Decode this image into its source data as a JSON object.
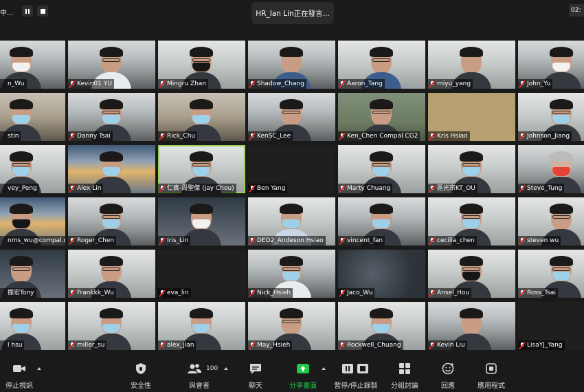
{
  "topbar": {
    "recording_text": "中...",
    "active_speaker": "HR_Ian Lin正在發言...",
    "timer": "02:"
  },
  "participants": [
    {
      "name": "n_Wu"
    },
    {
      "name": "Kevin01 YU"
    },
    {
      "name": "Mingru Zhan"
    },
    {
      "name": "Shadow_Chang"
    },
    {
      "name": "Aaron_Tang"
    },
    {
      "name": "miyu_yang"
    },
    {
      "name": "John_Yu"
    },
    {
      "name": "stin"
    },
    {
      "name": "Danny Tsai"
    },
    {
      "name": "Rick_Chu"
    },
    {
      "name": "KenSC_Lee"
    },
    {
      "name": "Ken_Chen Compal CG2"
    },
    {
      "name": "Kris Hsiao"
    },
    {
      "name": "Johnson_Jiang"
    },
    {
      "name": "vey_Peng"
    },
    {
      "name": "Alex Lin"
    },
    {
      "name": "仁賓-周聖傑 (Jay Chou)"
    },
    {
      "name": "Ben Yang"
    },
    {
      "name": "Marty Chuang"
    },
    {
      "name": "區光宗KT_OU"
    },
    {
      "name": "Steve_Tung"
    },
    {
      "name": "nms_wu@compal.c..."
    },
    {
      "name": "Roger_Chen"
    },
    {
      "name": "Iris_Lin"
    },
    {
      "name": "DED2_Andeson Hsiao"
    },
    {
      "name": "vincent_fan"
    },
    {
      "name": "cecilia_chen"
    },
    {
      "name": "steven wu"
    },
    {
      "name": "振宏Tony"
    },
    {
      "name": "Frankkk_Wu"
    },
    {
      "name": "eva_lin"
    },
    {
      "name": "Nick_Hsieh"
    },
    {
      "name": "Jaco_Wu"
    },
    {
      "name": "Ansel_Hou"
    },
    {
      "name": "Ross_Tsai"
    },
    {
      "name": "l hsu"
    },
    {
      "name": "miller_su"
    },
    {
      "name": "alex_jian"
    },
    {
      "name": "May_Hsieh"
    },
    {
      "name": "Rockwell_Chuang"
    },
    {
      "name": "Kevin Liu"
    },
    {
      "name": "LisaYJ_Yang"
    }
  ],
  "toolbar": {
    "stop_video": "停止視訊",
    "security": "安全性",
    "participants": "與會者",
    "participant_count": "100",
    "chat": "聊天",
    "share_screen": "分享畫面",
    "pause_recording": "暫停/停止錄製",
    "breakout": "分組討論",
    "reactions": "回應",
    "apps": "應用程式"
  },
  "colors": {
    "background": "#1a1a1a",
    "share_green": "#22c84a",
    "muted_red": "#e02828",
    "speaker_outline": "#9ad05a"
  }
}
